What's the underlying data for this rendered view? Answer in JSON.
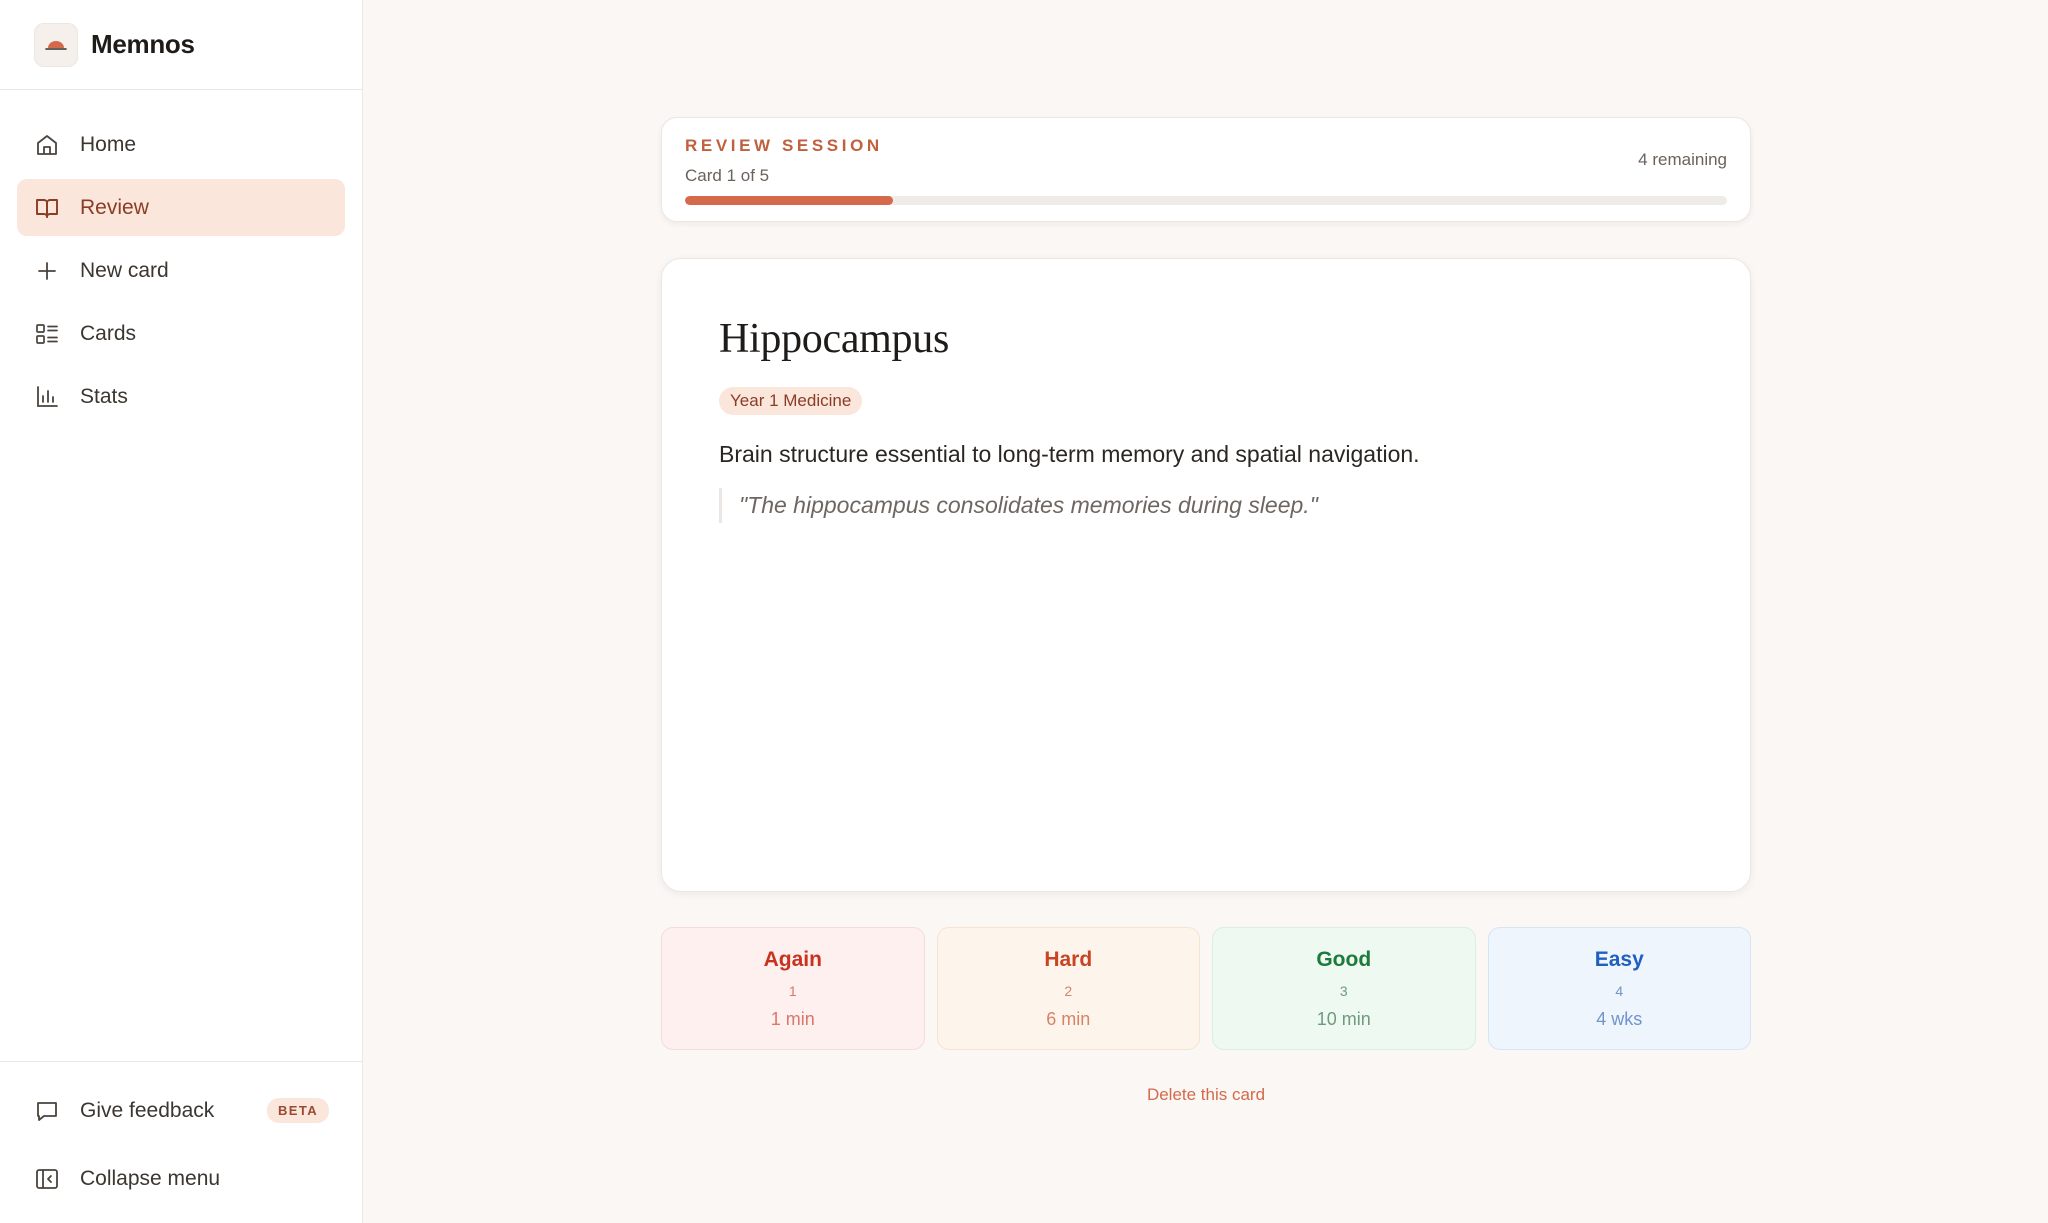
{
  "app": {
    "name": "Memnos"
  },
  "sidebar": {
    "items": [
      {
        "label": "Home",
        "icon": "home-icon",
        "active": false
      },
      {
        "label": "Review",
        "icon": "book-open-icon",
        "active": true
      },
      {
        "label": "New card",
        "icon": "plus-icon",
        "active": false
      },
      {
        "label": "Cards",
        "icon": "list-icon",
        "active": false
      },
      {
        "label": "Stats",
        "icon": "bar-chart-icon",
        "active": false
      }
    ],
    "footer": {
      "feedback_label": "Give feedback",
      "beta_badge": "BETA",
      "collapse_label": "Collapse menu"
    }
  },
  "session": {
    "title": "Review session",
    "progress_text": "Card 1 of 5",
    "remaining_text": "4 remaining",
    "progress_fraction": 0.2
  },
  "card": {
    "term": "Hippocampus",
    "deck": "Year 1 Medicine",
    "definition": "Brain structure essential to long-term memory and spatial navigation.",
    "example": "\"The hippocampus consolidates memories during sleep.\""
  },
  "grades": [
    {
      "name": "Again",
      "key": "1",
      "interval": "1 min"
    },
    {
      "name": "Hard",
      "key": "2",
      "interval": "6 min"
    },
    {
      "name": "Good",
      "key": "3",
      "interval": "10 min"
    },
    {
      "name": "Easy",
      "key": "4",
      "interval": "4 wks"
    }
  ],
  "actions": {
    "delete_label": "Delete this card"
  },
  "colors": {
    "accent": "#d46a4b",
    "active_nav_bg": "#fbe6dc",
    "again": "#c8321f",
    "hard": "#c84422",
    "good": "#1e7a3a",
    "easy": "#1f5fbf"
  }
}
